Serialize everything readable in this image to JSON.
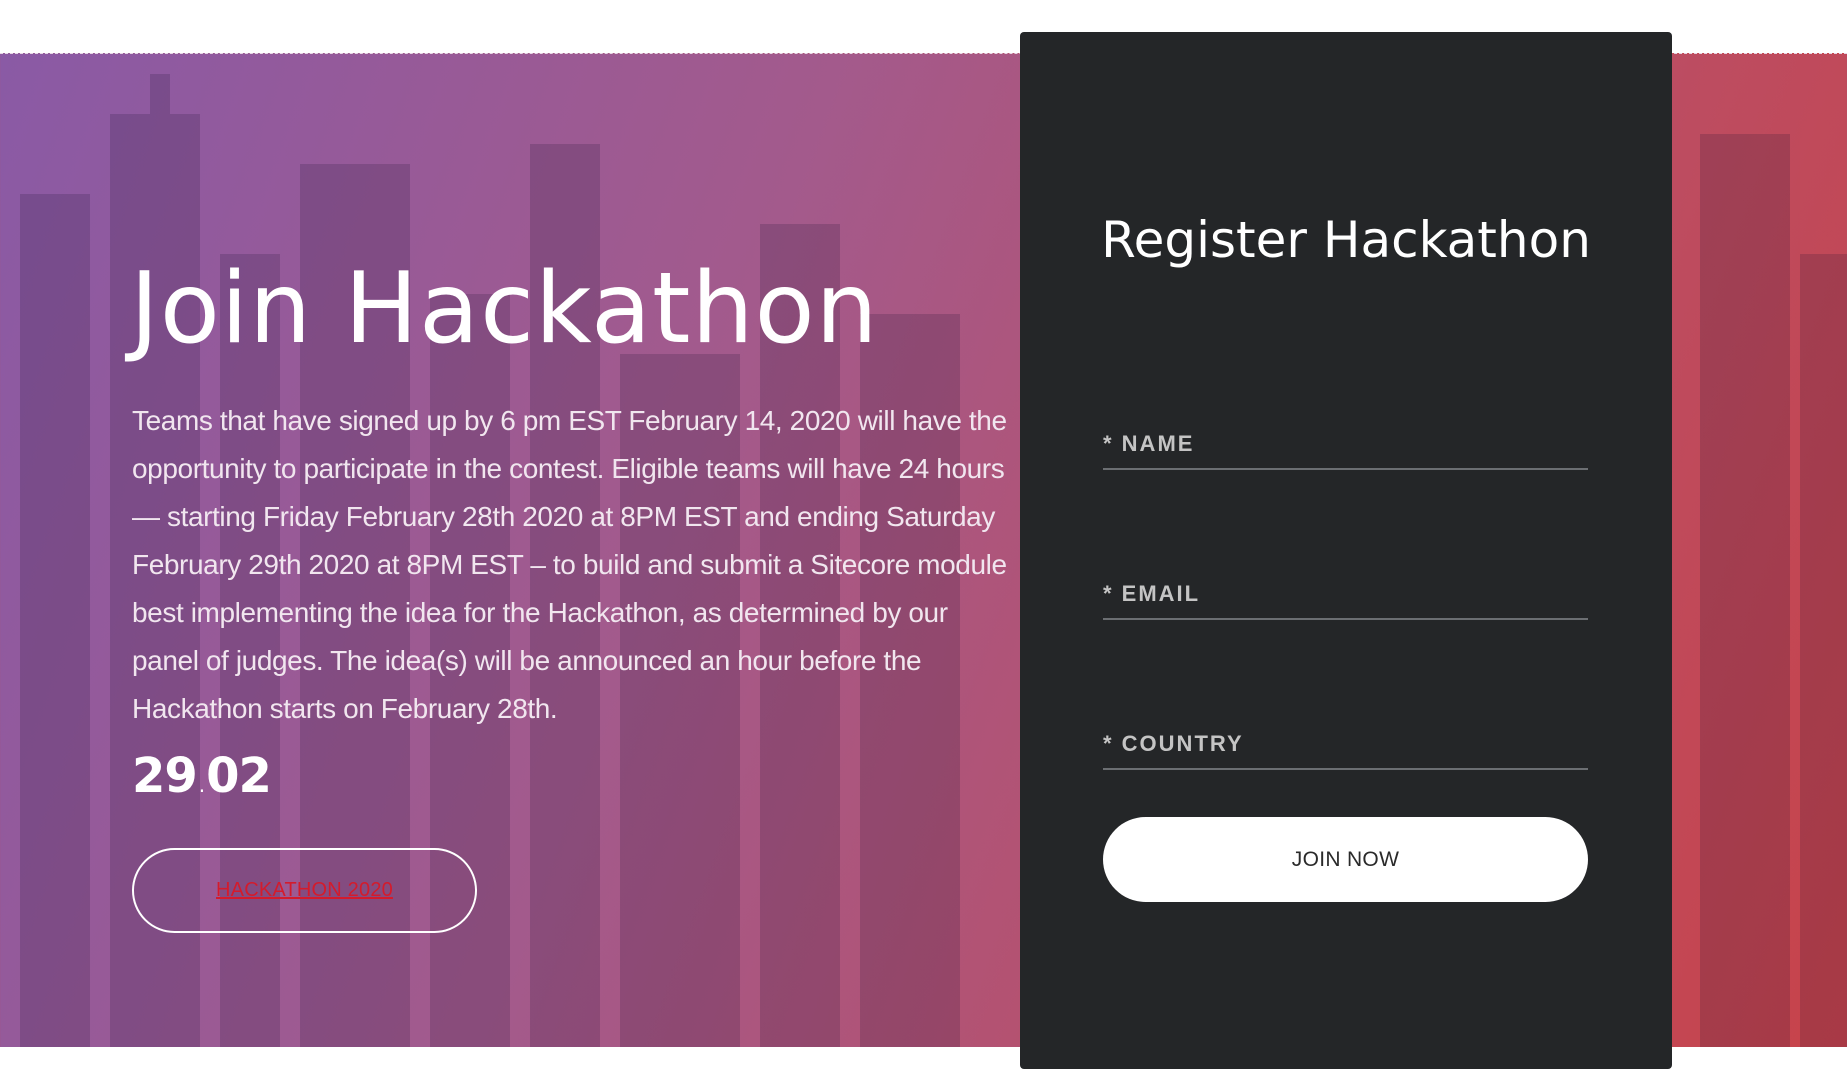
{
  "hero": {
    "title": "Join Hackathon",
    "description": "Teams that have signed up by 6 pm EST February 14, 2020 will have the opportunity to participate in the contest. Eligible teams will have 24 hours — starting Friday February 28th 2020 at 8PM EST and ending Saturday February 29th 2020 at 8PM EST – to build and submit a Sitecore module best implementing the idea for the Hackathon, as determined by our panel of judges. The idea(s) will be announced an hour before the Hackathon starts on February 28th.",
    "date_day": "29",
    "date_sep": ".",
    "date_month": "02",
    "button_label": "HACKATHON 2020",
    "link_color": "#d41b2c"
  },
  "form": {
    "title": "Register Hackathon",
    "name_placeholder": "* NAME",
    "email_placeholder": "* EMAIL",
    "country_placeholder": "* COUNTRY",
    "submit_label": "JOIN NOW"
  },
  "colors": {
    "gradient_start": "#8a5aa5",
    "gradient_end": "#c8434a",
    "card_bg": "#242628"
  }
}
